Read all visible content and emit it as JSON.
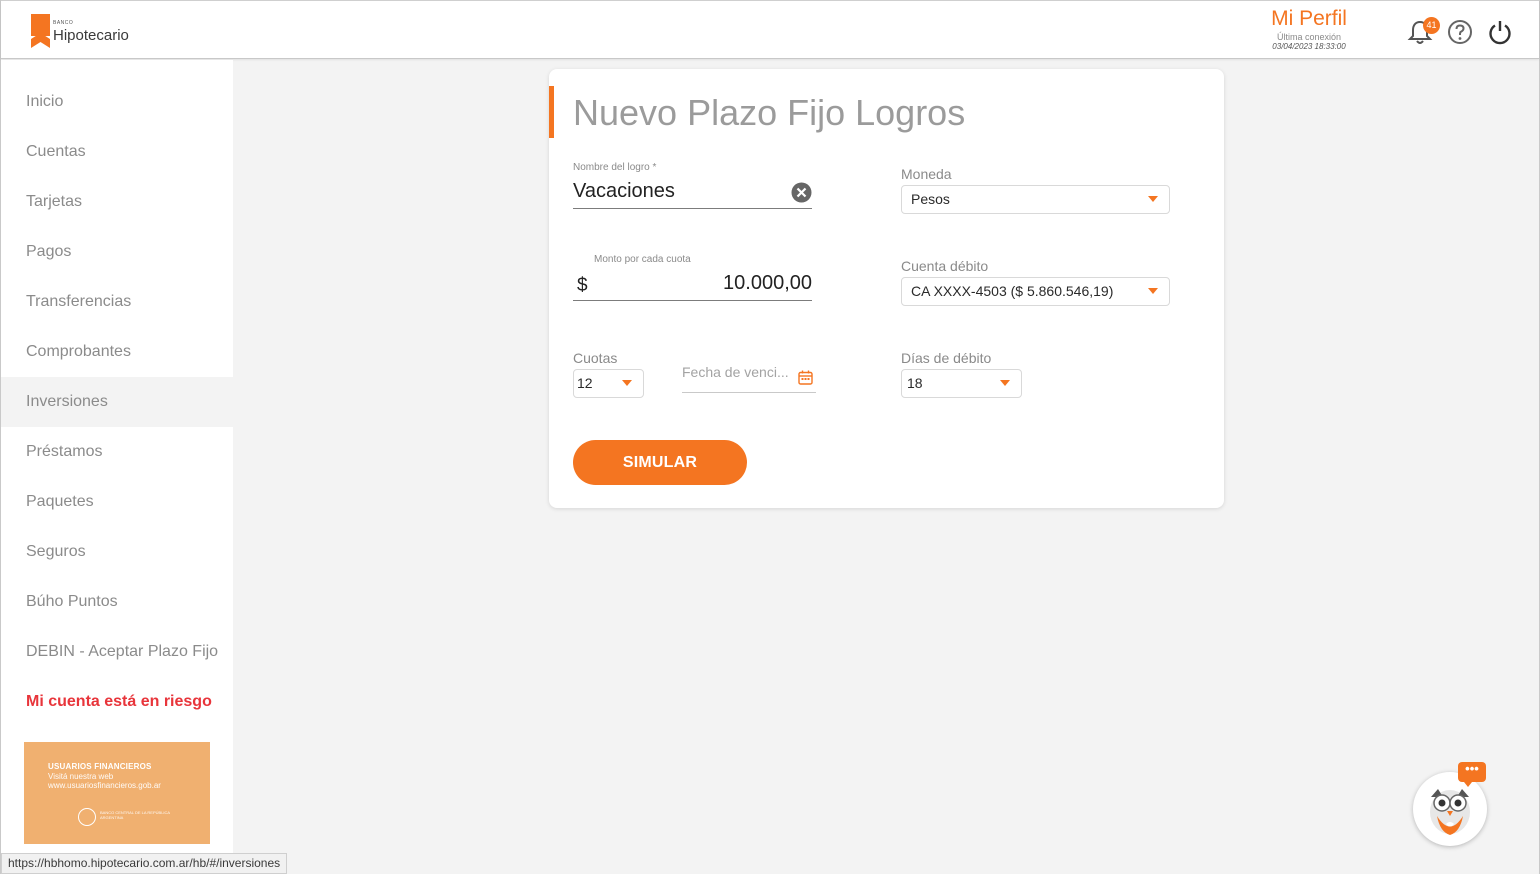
{
  "header": {
    "brand_small": "BANCO",
    "brand_name": "Hipotecario",
    "profile_name": "Mi Perfil",
    "last_login_label": "Última conexión",
    "last_login_date": "03/04/2023 18:33:00",
    "notifications_count": "41"
  },
  "sidebar": {
    "items": [
      {
        "label": "Inicio"
      },
      {
        "label": "Cuentas"
      },
      {
        "label": "Tarjetas"
      },
      {
        "label": "Pagos"
      },
      {
        "label": "Transferencias"
      },
      {
        "label": "Comprobantes"
      },
      {
        "label": "Inversiones"
      },
      {
        "label": "Préstamos"
      },
      {
        "label": "Paquetes"
      },
      {
        "label": "Seguros"
      },
      {
        "label": "Búho Puntos"
      },
      {
        "label": "DEBIN - Aceptar Plazo Fijo"
      },
      {
        "label": "Mi cuenta está en riesgo"
      }
    ],
    "banner": {
      "title": "USUARIOS FINANCIEROS",
      "line1": "Visitá nuestra web",
      "line2": "www.usuariosfinancieros.gob.ar",
      "footer": "BANCO CENTRAL DE LA REPÚBLICA ARGENTINA"
    }
  },
  "form": {
    "title": "Nuevo Plazo Fijo Logros",
    "goal_name_label": "Nombre del logro *",
    "goal_name_value": "Vacaciones",
    "currency_label": "Moneda",
    "currency_value": "Pesos",
    "amount_label": "Monto por cada cuota",
    "amount_prefix": "$",
    "amount_value": "10.000,00",
    "debit_account_label": "Cuenta débito",
    "debit_account_value": "CA XXXX-4503 ($ 5.860.546,19)",
    "installments_label": "Cuotas",
    "installments_value": "12",
    "due_date_placeholder": "Fecha de venci...",
    "debit_days_label": "Días de débito",
    "debit_days_value": "18",
    "simulate_button": "SIMULAR"
  },
  "status_bar": {
    "url": "https://hbhomo.hipotecario.com.ar/hb/#/inversiones"
  },
  "chatbot": {
    "bubble_glyph": "•••"
  },
  "colors": {
    "accent": "#f47521",
    "alert": "#e8353b",
    "background": "#f3f3f3"
  }
}
